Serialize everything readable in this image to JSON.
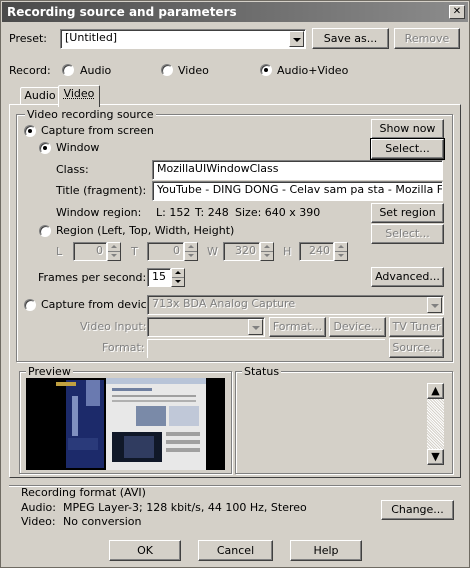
{
  "window": {
    "title": "Recording source and parameters",
    "close_glyph": "✕"
  },
  "preset": {
    "label": "Preset:",
    "value": "[Untitled]",
    "save_as": "Save as...",
    "remove": "Remove"
  },
  "record": {
    "label": "Record:",
    "options": [
      "Audio",
      "Video",
      "Audio+Video"
    ],
    "selected": "Audio+Video"
  },
  "tabs": [
    "Audio",
    "Video"
  ],
  "active_tab": "Video",
  "source": {
    "group_title": "Video recording source",
    "capture_screen": "Capture from screen",
    "show_now": "Show now",
    "window_label": "Window",
    "select": "Select...",
    "class_label": "Class:",
    "class_value": "MozillaUIWindowClass",
    "title_label": "Title (fragment):",
    "title_value": "YouTube - DING DONG - Celav sam pa sta - Mozilla Firefox",
    "region_label": "Window region:",
    "region_l": "L: 152",
    "region_t": "T: 248",
    "region_size": "Size: 640 x 390",
    "set_region": "Set region",
    "region_option": "Region (Left, Top, Width, Height)",
    "select_region": "Select...",
    "l_label": "L",
    "l_value": "0",
    "t_label": "T",
    "t_value": "0",
    "w_label": "W",
    "w_value": "320",
    "h_label": "H",
    "h_value": "240",
    "fps_label": "Frames per second:",
    "fps_value": "15",
    "advanced": "Advanced...",
    "device_option": "Capture from device:",
    "device_value": "713x BDA Analog Capture",
    "video_input_label": "Video Input:",
    "format_btn": "Format...",
    "device_btn": "Device...",
    "tv_tuner": "TV Tuner",
    "format_label": "Format:",
    "source_btn": "Source..."
  },
  "preview": {
    "title": "Preview"
  },
  "status": {
    "title": "Status"
  },
  "recording_format": {
    "title": "Recording format (AVI)",
    "audio_label": "Audio:",
    "audio_value": "MPEG Layer-3; 128 kbit/s, 44 100 Hz, Stereo",
    "video_label": "Video:",
    "video_value": "No conversion",
    "change": "Change..."
  },
  "footer": {
    "ok": "OK",
    "cancel": "Cancel",
    "help": "Help"
  }
}
